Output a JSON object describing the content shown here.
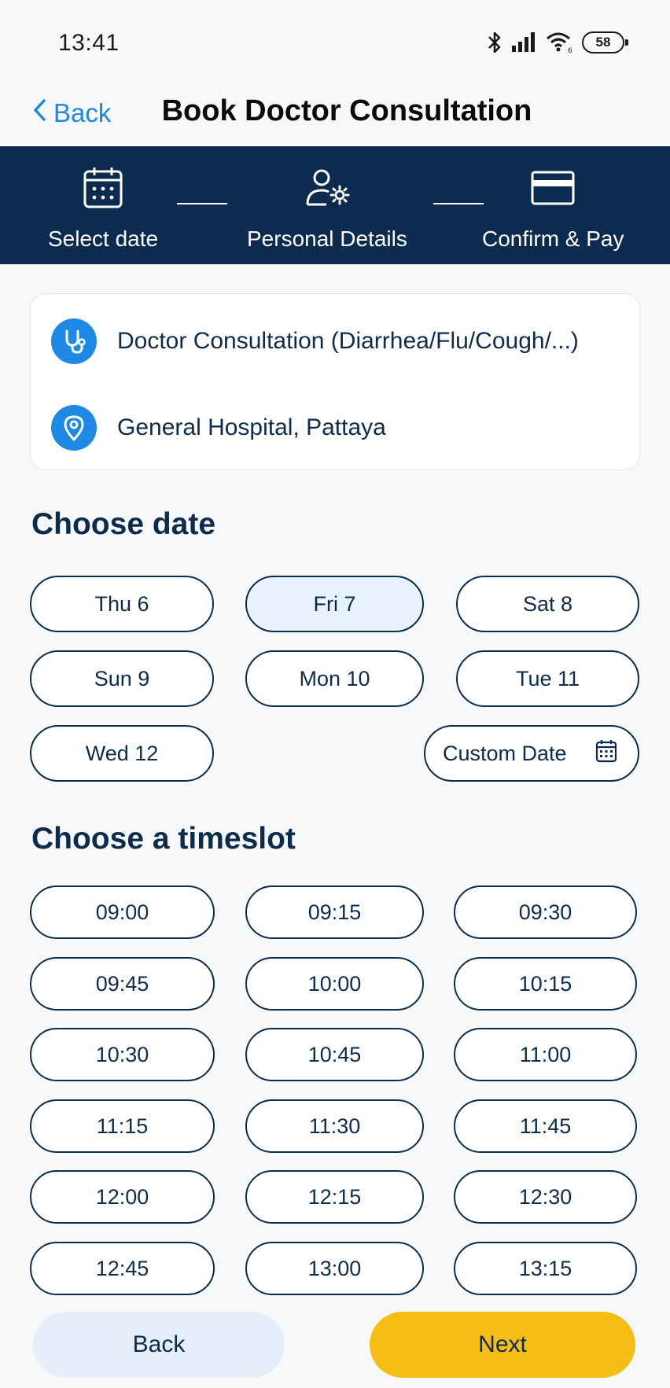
{
  "status_bar": {
    "time": "13:41",
    "battery": "58"
  },
  "nav": {
    "back_label": "Back",
    "title": "Book Doctor Consultation"
  },
  "steps": [
    {
      "label": "Select date",
      "icon": "calendar-icon"
    },
    {
      "label": "Personal Details",
      "icon": "user-gear-icon"
    },
    {
      "label": "Confirm & Pay",
      "icon": "credit-card-icon"
    }
  ],
  "info": {
    "service": "Doctor Consultation (Diarrhea/Flu/Cough/...)",
    "location": "General Hospital, Pattaya"
  },
  "date_section": {
    "title": "Choose date",
    "dates": [
      "Thu 6",
      "Fri 7",
      "Sat 8",
      "Sun 9",
      "Mon 10",
      "Tue 11",
      "Wed 12"
    ],
    "selected": "Fri 7",
    "custom_label": "Custom Date"
  },
  "time_section": {
    "title": "Choose a timeslot",
    "slots": [
      "09:00",
      "09:15",
      "09:30",
      "09:45",
      "10:00",
      "10:15",
      "10:30",
      "10:45",
      "11:00",
      "11:15",
      "11:30",
      "11:45",
      "12:00",
      "12:15",
      "12:30",
      "12:45",
      "13:00",
      "13:15"
    ]
  },
  "footer": {
    "back_label": "Back",
    "next_label": "Next"
  },
  "colors": {
    "navy": "#0c2b4e",
    "accent_blue": "#1e88e5",
    "next_yellow": "#f5be14",
    "selected_bg": "#e8f2fd"
  }
}
